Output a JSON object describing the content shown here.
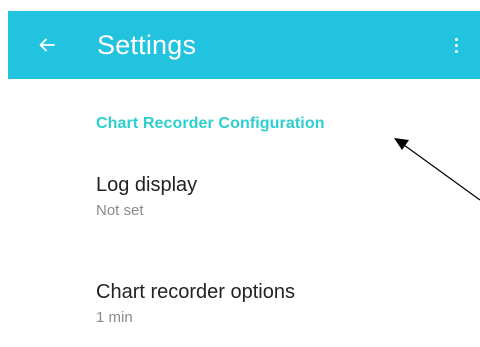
{
  "app_bar": {
    "title": "Settings",
    "back_icon": "arrow-left-icon",
    "menu_icon": "more-vertical-icon",
    "color": "#22c3df"
  },
  "section": {
    "header": "Chart Recorder Configuration",
    "accent_color": "#2ccfcf"
  },
  "preferences": [
    {
      "title": "Log display",
      "summary": "Not set"
    },
    {
      "title": "Chart recorder options",
      "summary": "1 min"
    }
  ],
  "annotation": {
    "icon": "arrow-annotation-icon"
  }
}
